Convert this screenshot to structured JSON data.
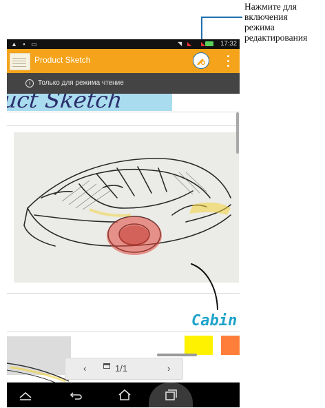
{
  "callout": {
    "text_lines": [
      "Нажмите для",
      "включения",
      "режима",
      "редактирования"
    ]
  },
  "status_bar": {
    "time": "17:32"
  },
  "action_bar": {
    "title": "Product Sketch"
  },
  "notice": {
    "text": "Только для режима чтение",
    "icon": "info-icon"
  },
  "note": {
    "title_handwriting": "uct Sketch",
    "annotation": "Cabin"
  },
  "pager": {
    "counter": "1/1",
    "prev_glyph": "‹",
    "next_glyph": "›"
  },
  "colors": {
    "action_bar": "#f5a31a",
    "notice_bar": "#444444",
    "callout_line": "#1f6fb0",
    "cabin_text": "#1fa3c9",
    "swatch_yellow": "#fff200",
    "swatch_orange": "#ff7f3a"
  }
}
